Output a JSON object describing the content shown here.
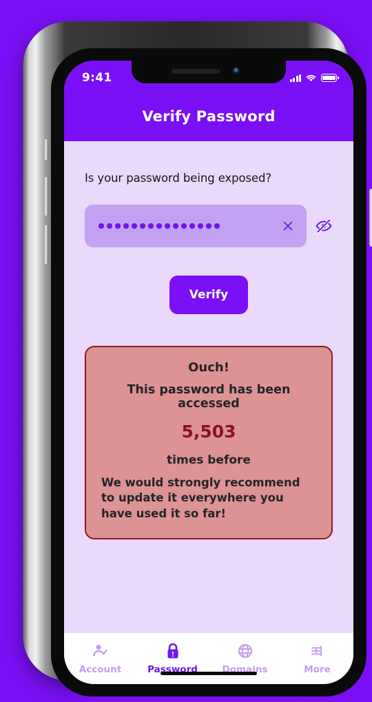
{
  "status_bar": {
    "time": "9:41",
    "icons": [
      "cellular-signal-icon",
      "wifi-icon",
      "battery-icon"
    ]
  },
  "header": {
    "title": "Verify Password"
  },
  "main": {
    "question": "Is your password being exposed?",
    "password_field": {
      "value": "•••••••••••••••",
      "dot_count": 15,
      "masked": true,
      "placeholder": "Password",
      "clear_icon": "close-icon",
      "visibility_icon": "eye-off-icon"
    },
    "verify_button": "Verify",
    "alert": {
      "heading": "Ouch!",
      "line": "This password has been accessed",
      "count": "5,503",
      "suffix": "times before",
      "advice": "We would strongly recommend to update it everywhere you have used it so far!"
    }
  },
  "tabbar": {
    "items": [
      {
        "label": "Account",
        "icon": "user-check-icon",
        "active": false
      },
      {
        "label": "Password",
        "icon": "lock-alert-icon",
        "active": true
      },
      {
        "label": "Domains",
        "icon": "globe-icon",
        "active": false
      },
      {
        "label": "More",
        "icon": "sliders-icon",
        "active": false
      }
    ]
  },
  "colors": {
    "brand_purple": "#7A10F5",
    "screen_background": "#e9d9fb",
    "field_background": "#c3a2f3",
    "alert_background": "#dd9393",
    "alert_border": "#8d1b25",
    "count_red": "#8d1020",
    "tab_inactive": "#c49cf2",
    "tab_active": "#6b18e8"
  }
}
